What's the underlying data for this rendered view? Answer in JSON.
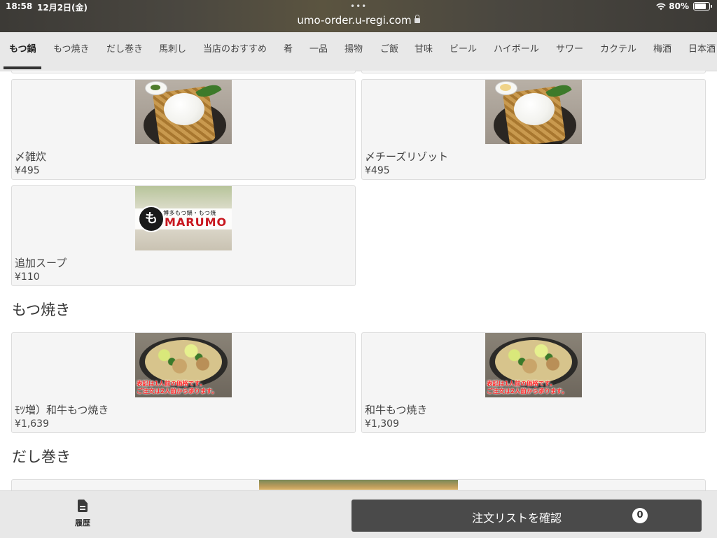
{
  "status_bar": {
    "time": "18:58",
    "date": "12月2日(金)",
    "wifi": "wifi",
    "battery": "80%"
  },
  "browser": {
    "url": "umo-order.u-regi.com"
  },
  "tabs": [
    {
      "label": "もつ鍋",
      "active": true
    },
    {
      "label": "もつ焼き"
    },
    {
      "label": "だし巻き"
    },
    {
      "label": "馬刺し"
    },
    {
      "label": "当店のおすすめ"
    },
    {
      "label": "肴"
    },
    {
      "label": "一品"
    },
    {
      "label": "揚物"
    },
    {
      "label": "ご飯"
    },
    {
      "label": "甘味"
    },
    {
      "label": "ビール"
    },
    {
      "label": "ハイボール"
    },
    {
      "label": "サワー"
    },
    {
      "label": "カクテル"
    },
    {
      "label": "梅酒"
    },
    {
      "label": "日本酒"
    }
  ],
  "items": {
    "zosui": {
      "name": "〆雑炊",
      "price": "¥495"
    },
    "cheese_risotto": {
      "name": "〆チーズリゾット",
      "price": "¥495"
    },
    "extra_soup": {
      "name": "追加スープ",
      "price": "¥110"
    },
    "wagyu_motsuyaki_large": {
      "name": "ﾓﾂ増）和牛もつ焼き",
      "price": "¥1,639"
    },
    "wagyu_motsuyaki": {
      "name": "和牛もつ焼き",
      "price": "¥1,309"
    }
  },
  "sections": {
    "motsuyaki": "もつ焼き",
    "dashimaki": "だし巻き"
  },
  "thumb_text": {
    "marumo_sub": "博多もつ鍋・もつ焼",
    "marumo_logo": "MARUMO",
    "marumo_circle": "も",
    "motsu_note_1": "表記は1人前の価格です。",
    "motsu_note_2": "ご注文は2人前から承ります。"
  },
  "bottom_bar": {
    "history_label": "履歴",
    "order_button_label": "注文リストを確認",
    "order_count": "0"
  }
}
